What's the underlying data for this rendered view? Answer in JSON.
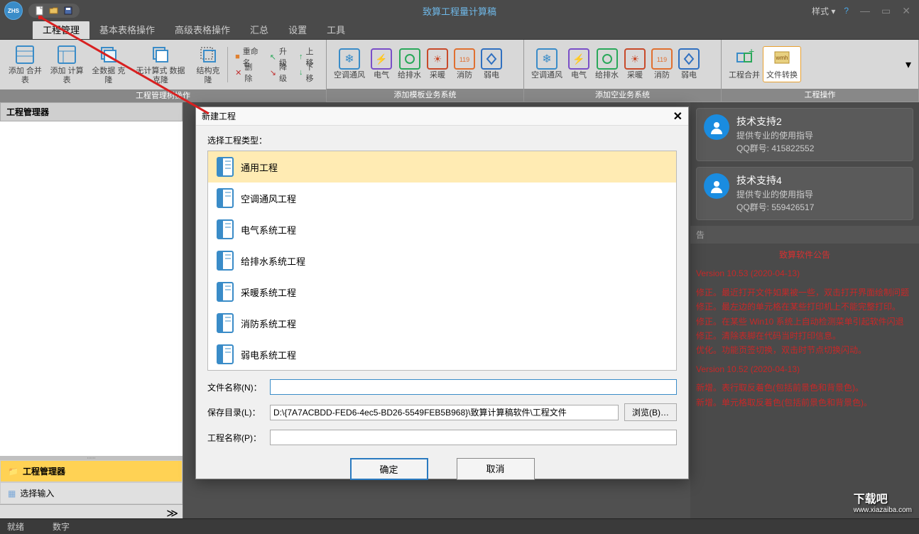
{
  "title": "致算工程量计算稿",
  "style_menu": "样式 ▾",
  "menu": {
    "tabs": [
      "工程管理",
      "基本表格操作",
      "高级表格操作",
      "汇总",
      "设置",
      "工具"
    ]
  },
  "ribbon": {
    "g0": {
      "label": "工程管理树操作",
      "btns": [
        "添加\n合并表",
        "添加\n计算表",
        "全数据\n克隆",
        "无计算式\n数据克隆",
        "结构克隆"
      ],
      "small": [
        "重命名",
        "删 除",
        "升级",
        "降级",
        "上移",
        "下移"
      ]
    },
    "g1": {
      "label": "添加模板业务系统",
      "btns": [
        "空调通风",
        "电气",
        "给排水",
        "采暖",
        "消防",
        "弱电"
      ]
    },
    "g2": {
      "label": "添加空业务系统",
      "btns": [
        "空调通风",
        "电气",
        "给排水",
        "采暖",
        "消防",
        "弱电"
      ]
    },
    "g3": {
      "label": "工程操作",
      "btns": [
        "工程合并",
        "文件转换"
      ]
    }
  },
  "left": {
    "header": "工程管理器",
    "items": [
      "工程管理器",
      "选择输入"
    ]
  },
  "dialog": {
    "title": "新建工程",
    "type_label": "选择工程类型：",
    "types": [
      "通用工程",
      "空调通风工程",
      "电气系统工程",
      "给排水系统工程",
      "采暖系统工程",
      "消防系统工程",
      "弱电系统工程"
    ],
    "filename_label": "文件名称(N)：",
    "filename": "",
    "savedir_label": "保存目录(L)：",
    "savedir": "D:\\{7A7ACBDD-FED6-4ec5-BD26-5549FEB5B968}\\致算计算稿软件\\工程文件",
    "browse": "浏览(B)…",
    "projname_label": "工程名称(P)：",
    "projname": "",
    "ok": "确定",
    "cancel": "取消"
  },
  "right": {
    "support2": {
      "title": "技术支持2",
      "desc": "提供专业的使用指导",
      "qq": "QQ群号: 415822552"
    },
    "support4": {
      "title": "技术支持4",
      "desc": "提供专业的使用指导",
      "qq": "QQ群号: 559426517"
    },
    "announce_hdr": "告",
    "announce_title": "致算软件公告",
    "v1": "Version 10.53  (2020-04-13)",
    "lines1": [
      "修正。最近打开文件如果被一些，双击打开界面绘制问题",
      "修正。最左边的单元格在某些打印机上不能完整打印。",
      "修正。在某些 Win10 系统上自动检测菜单引起软件闪退",
      "修正。清除表脚在代码当时打印信息。",
      "优化。功能页签切换，双击时节点切换闪动。"
    ],
    "v2": "Version 10.52  (2020-04-13)",
    "lines2": [
      "新增。表行取反着色(包括前景色和背景色)。",
      "新增。单元格取反着色(包括前景色和背景色)。"
    ]
  },
  "status": {
    "ready": "就绪",
    "num": "数字"
  },
  "watermark": {
    "site": "www.xiazaiba.com",
    "name": "下载吧"
  }
}
